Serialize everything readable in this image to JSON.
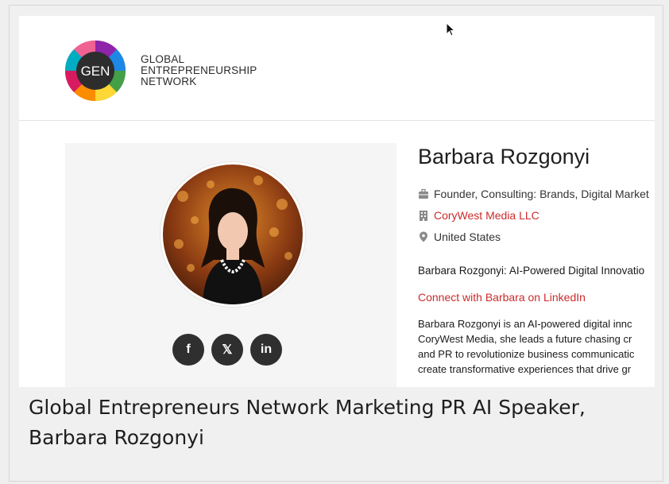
{
  "logo": {
    "badge": "GEN",
    "lines": [
      "GLOBAL",
      "ENTREPRENEURSHIP",
      "NETWORK"
    ]
  },
  "profile": {
    "name": "Barbara Rozgonyi",
    "role": "Founder, Consulting: Brands, Digital Market",
    "company": "CoryWest Media LLC",
    "location": "United States",
    "bio_title": "Barbara Rozgonyi: AI-Powered Digital Innovatio",
    "linkedin_link": "Connect with Barbara on LinkedIn",
    "bio_lines": [
      "Barbara Rozgonyi is an AI-powered digital innc",
      "CoryWest Media, she leads a future chasing cr",
      "and PR to revolutionize business communicatic",
      "create transformative experiences that drive gr"
    ]
  },
  "social": {
    "facebook": "f",
    "x": "𝕏",
    "linkedin": "in"
  },
  "caption": "Global Entrepreneurs Network Marketing PR AI Speaker, Barbara Rozgonyi",
  "colors": {
    "accent": "#cc2b2b",
    "badge_bg": "#2d2d2d"
  }
}
